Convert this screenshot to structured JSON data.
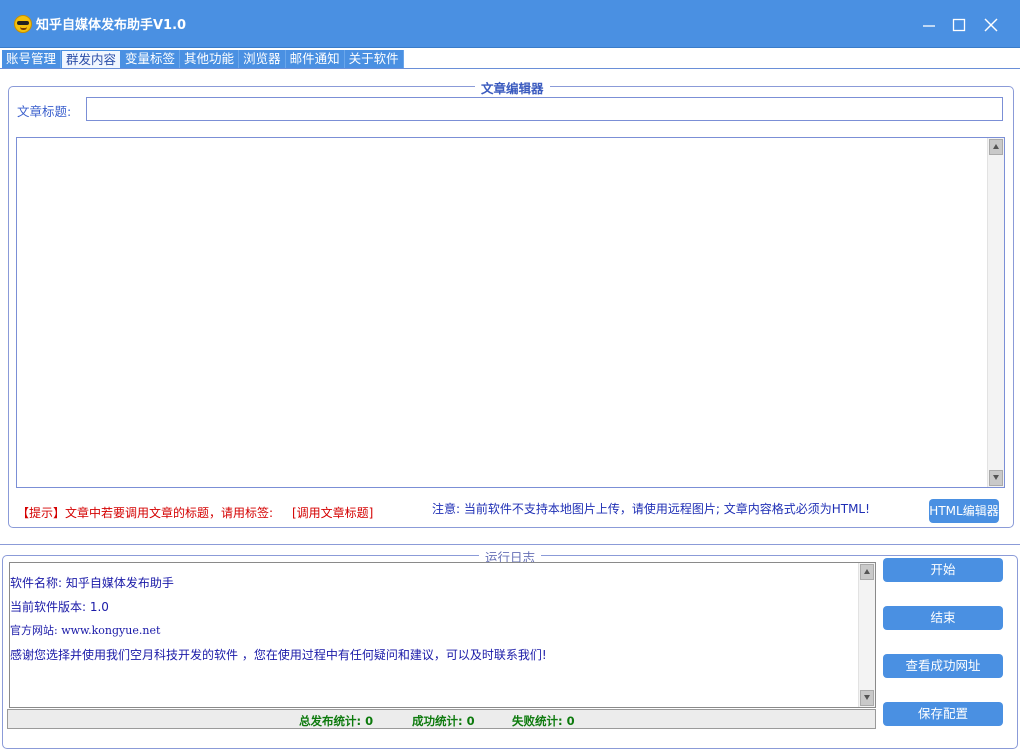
{
  "window": {
    "title": "知乎自媒体发布助手V1.0",
    "accent_color": "#4a90e2"
  },
  "tabs": [
    {
      "label": "账号管理",
      "active": false
    },
    {
      "label": "群发内容",
      "active": true
    },
    {
      "label": "变量标签",
      "active": false
    },
    {
      "label": "其他功能",
      "active": false
    },
    {
      "label": "浏览器",
      "active": false
    },
    {
      "label": "邮件通知",
      "active": false
    },
    {
      "label": "关于软件",
      "active": false
    }
  ],
  "editor": {
    "legend": "文章编辑器",
    "title_label": "文章标题:",
    "title_value": "",
    "content_value": "",
    "hint_prefix": "【提示】文章中若要调用文章的标题，请用标签:",
    "hint_tag": "[调用文章标题]",
    "notice": "注意: 当前软件不支持本地图片上传，请使用远程图片; 文章内容格式必须为HTML!",
    "html_editor_button": "HTML编辑器"
  },
  "log": {
    "legend": "运行日志",
    "lines": [
      "软件名称: 知乎自媒体发布助手",
      "当前软件版本: 1.0",
      "官方网站: www.kongyue.net",
      "感谢您选择并使用我们空月科技开发的软件 ，您在使用过程中有任何疑问和建议，可以及时联系我们!"
    ]
  },
  "stats": {
    "total": "总发布统计: 0",
    "success": "成功统计: 0",
    "fail": "失败统计: 0"
  },
  "actions": {
    "start": "开始",
    "stop": "结束",
    "view_success": "查看成功网址",
    "save_config": "保存配置"
  }
}
